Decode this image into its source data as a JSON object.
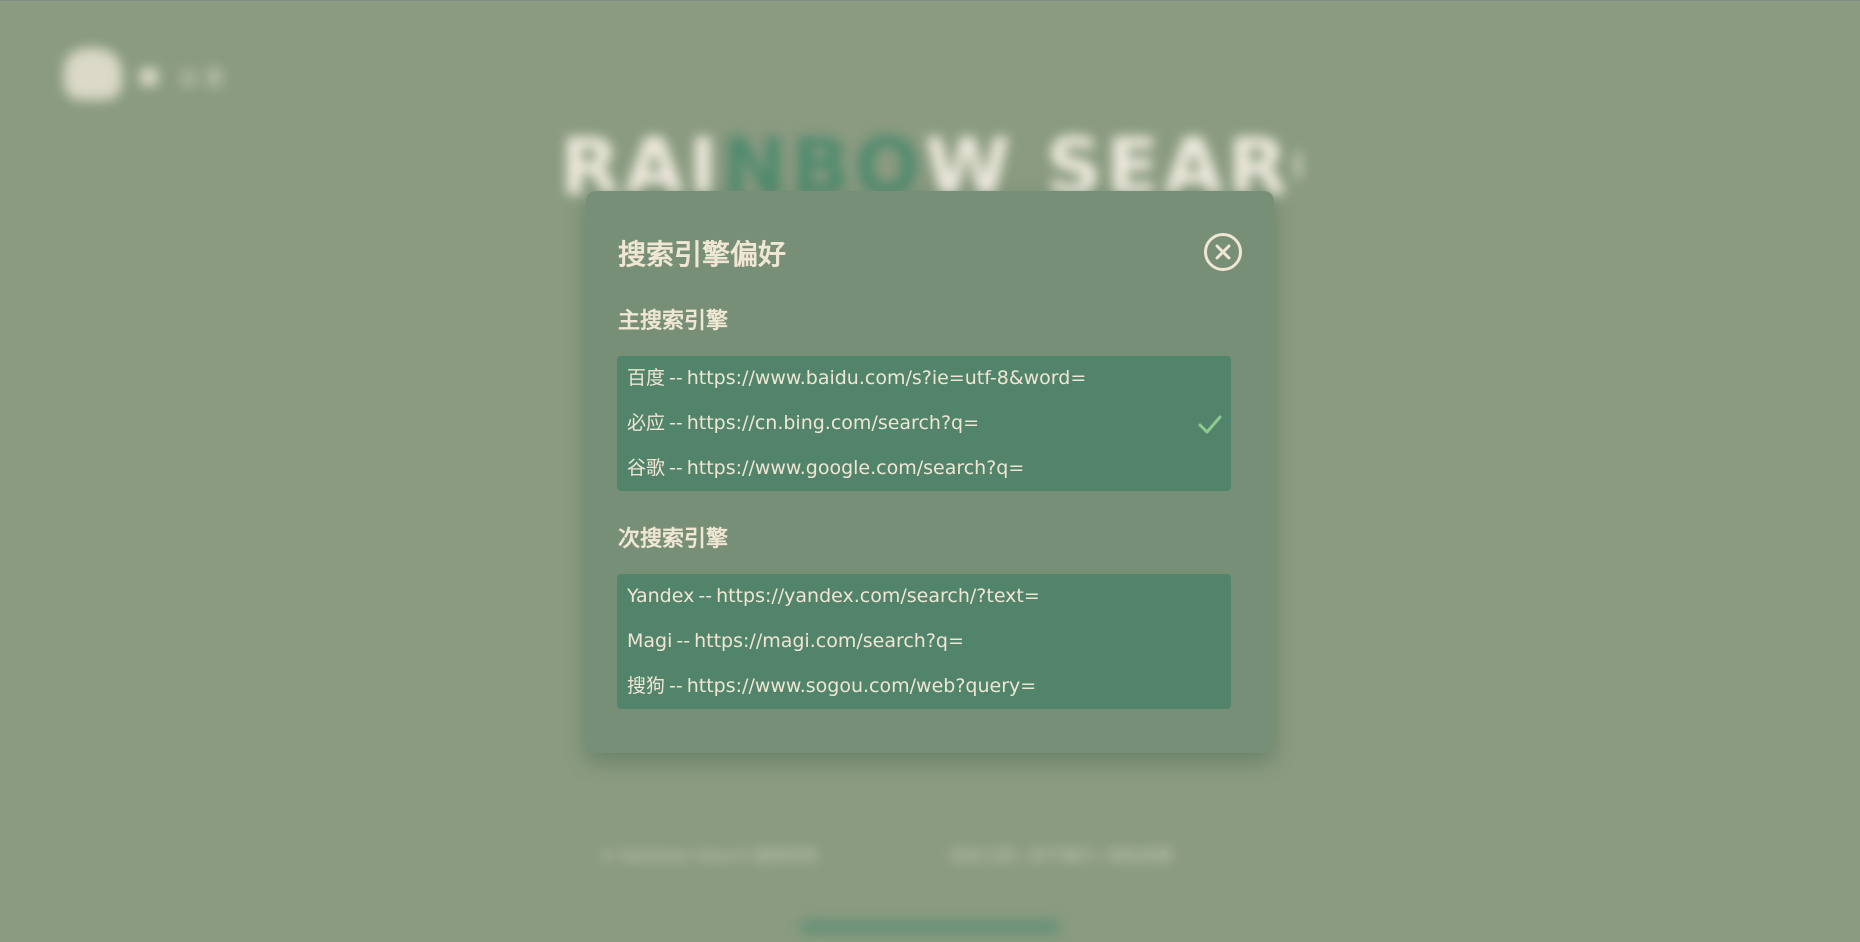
{
  "background": {
    "nav_text": "设 置",
    "title_left": "RAI",
    "title_mid": "NBO",
    "title_right": "W SEARCH",
    "footer_left": "© Rainbow Search 版权所有",
    "footer_right": "站长工具 | 关于我们 | 隐私政策",
    "colors": {
      "bg": "#8a9b81",
      "accent": "#4f8a6e"
    }
  },
  "modal": {
    "title": "搜索引擎偏好",
    "close_icon": "close-circle-icon",
    "primary": {
      "heading": "主搜索引擎",
      "engines": [
        {
          "name": "百度",
          "separator": "--",
          "url": "https://www.baidu.com/s?ie=utf-8&word=",
          "selected": false
        },
        {
          "name": "必应",
          "separator": "--",
          "url": "https://cn.bing.com/search?q=",
          "selected": true
        },
        {
          "name": "谷歌",
          "separator": "--",
          "url": "https://www.google.com/search?q=",
          "selected": false
        }
      ]
    },
    "secondary": {
      "heading": "次搜索引擎",
      "engines": [
        {
          "name": "Yandex",
          "separator": "--",
          "url": "https://yandex.com/search/?text=",
          "selected": false
        },
        {
          "name": "Magi",
          "separator": "--",
          "url": "https://magi.com/search?q=",
          "selected": false
        },
        {
          "name": "搜狗",
          "separator": "--",
          "url": "https://www.sogou.com/web?query=",
          "selected": false
        }
      ]
    },
    "colors": {
      "panel": "#778f77",
      "list_bg": "#52846c",
      "text": "#efe6d4",
      "check": "#8fc98f"
    }
  }
}
